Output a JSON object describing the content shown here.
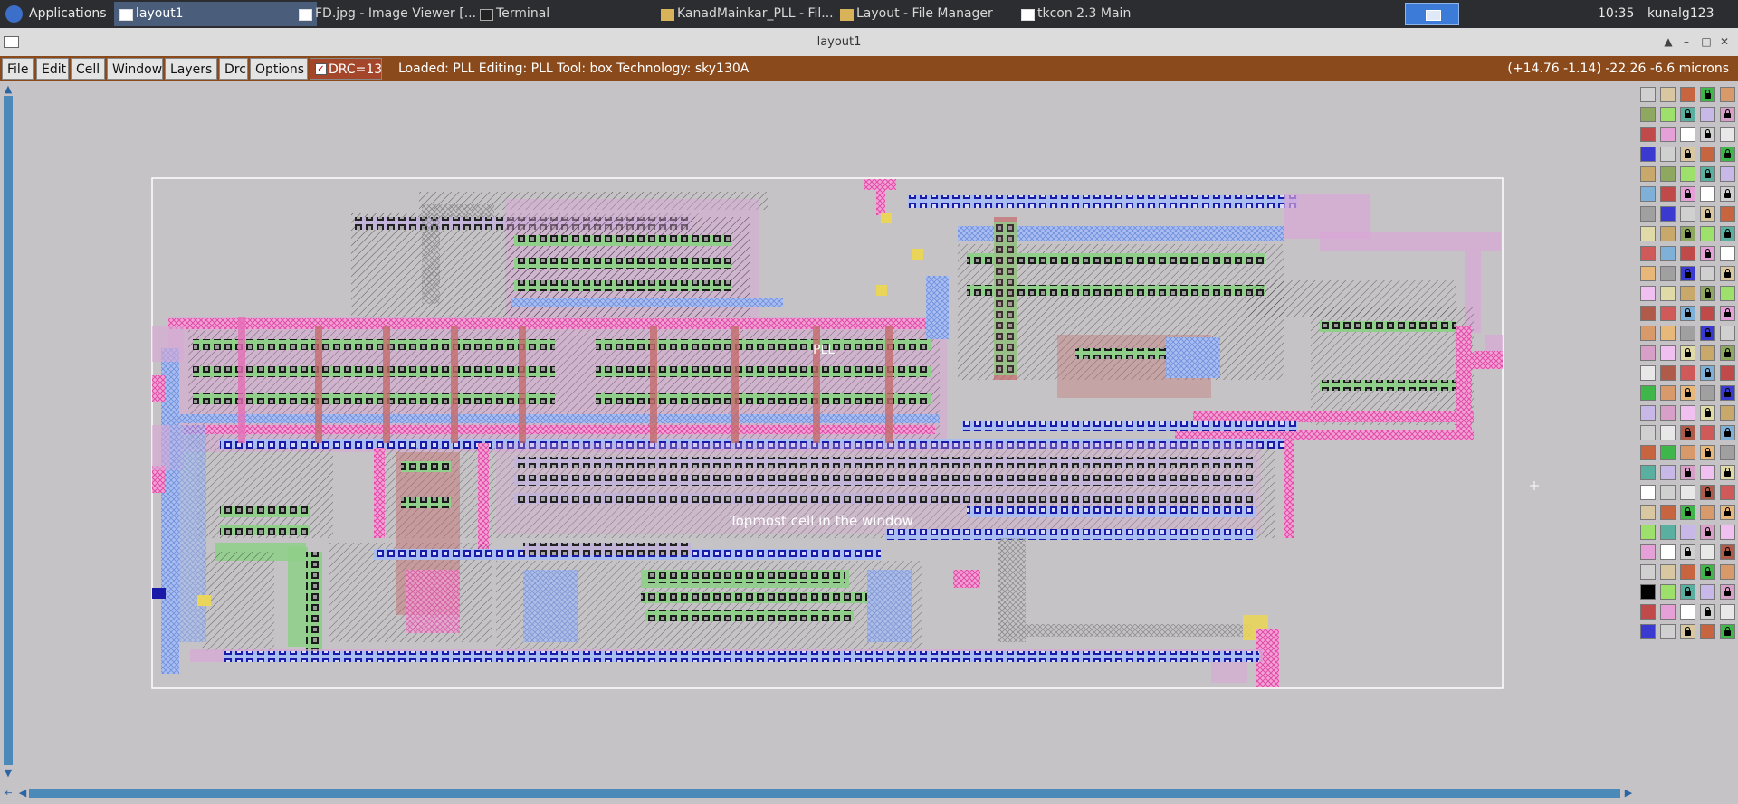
{
  "taskbar": {
    "applications_label": "Applications",
    "tasks": [
      {
        "label": "layout1",
        "active": true
      },
      {
        "label": "FD.jpg - Image Viewer [...",
        "active": false
      },
      {
        "label": "Terminal",
        "active": false
      },
      {
        "label": "KanadMainkar_PLL - Fil...",
        "active": false
      },
      {
        "label": "Layout - File Manager",
        "active": false
      },
      {
        "label": "tkcon 2.3 Main",
        "active": false
      }
    ],
    "clock": "10:35",
    "user": "kunalg123"
  },
  "window": {
    "title": "layout1"
  },
  "menubar": {
    "items": [
      "File",
      "Edit",
      "Cell",
      "Window",
      "Layers",
      "Drc",
      "Options"
    ],
    "drc_label": "DRC=13",
    "drc_checked": true,
    "status": "Loaded: PLL Editing: PLL Tool: box  Technology: sky130A",
    "coords": "(+14.76 -1.14) -22.26 -6.6 microns"
  },
  "layout": {
    "cell_label": "PLL",
    "topmost_label": "Topmost cell in the window"
  },
  "colors": {
    "menubar_bg": "#8b4a1b",
    "canvas_bg": "#c6c3c6",
    "metal1": "#9bb0e8",
    "metal2": "#d9a6d6",
    "poly": "#e66fb8",
    "diff": "#8fcf8a",
    "locali": "#c46b6b",
    "contact": "#1a1aa8",
    "scroll": "#4b8ab8"
  }
}
